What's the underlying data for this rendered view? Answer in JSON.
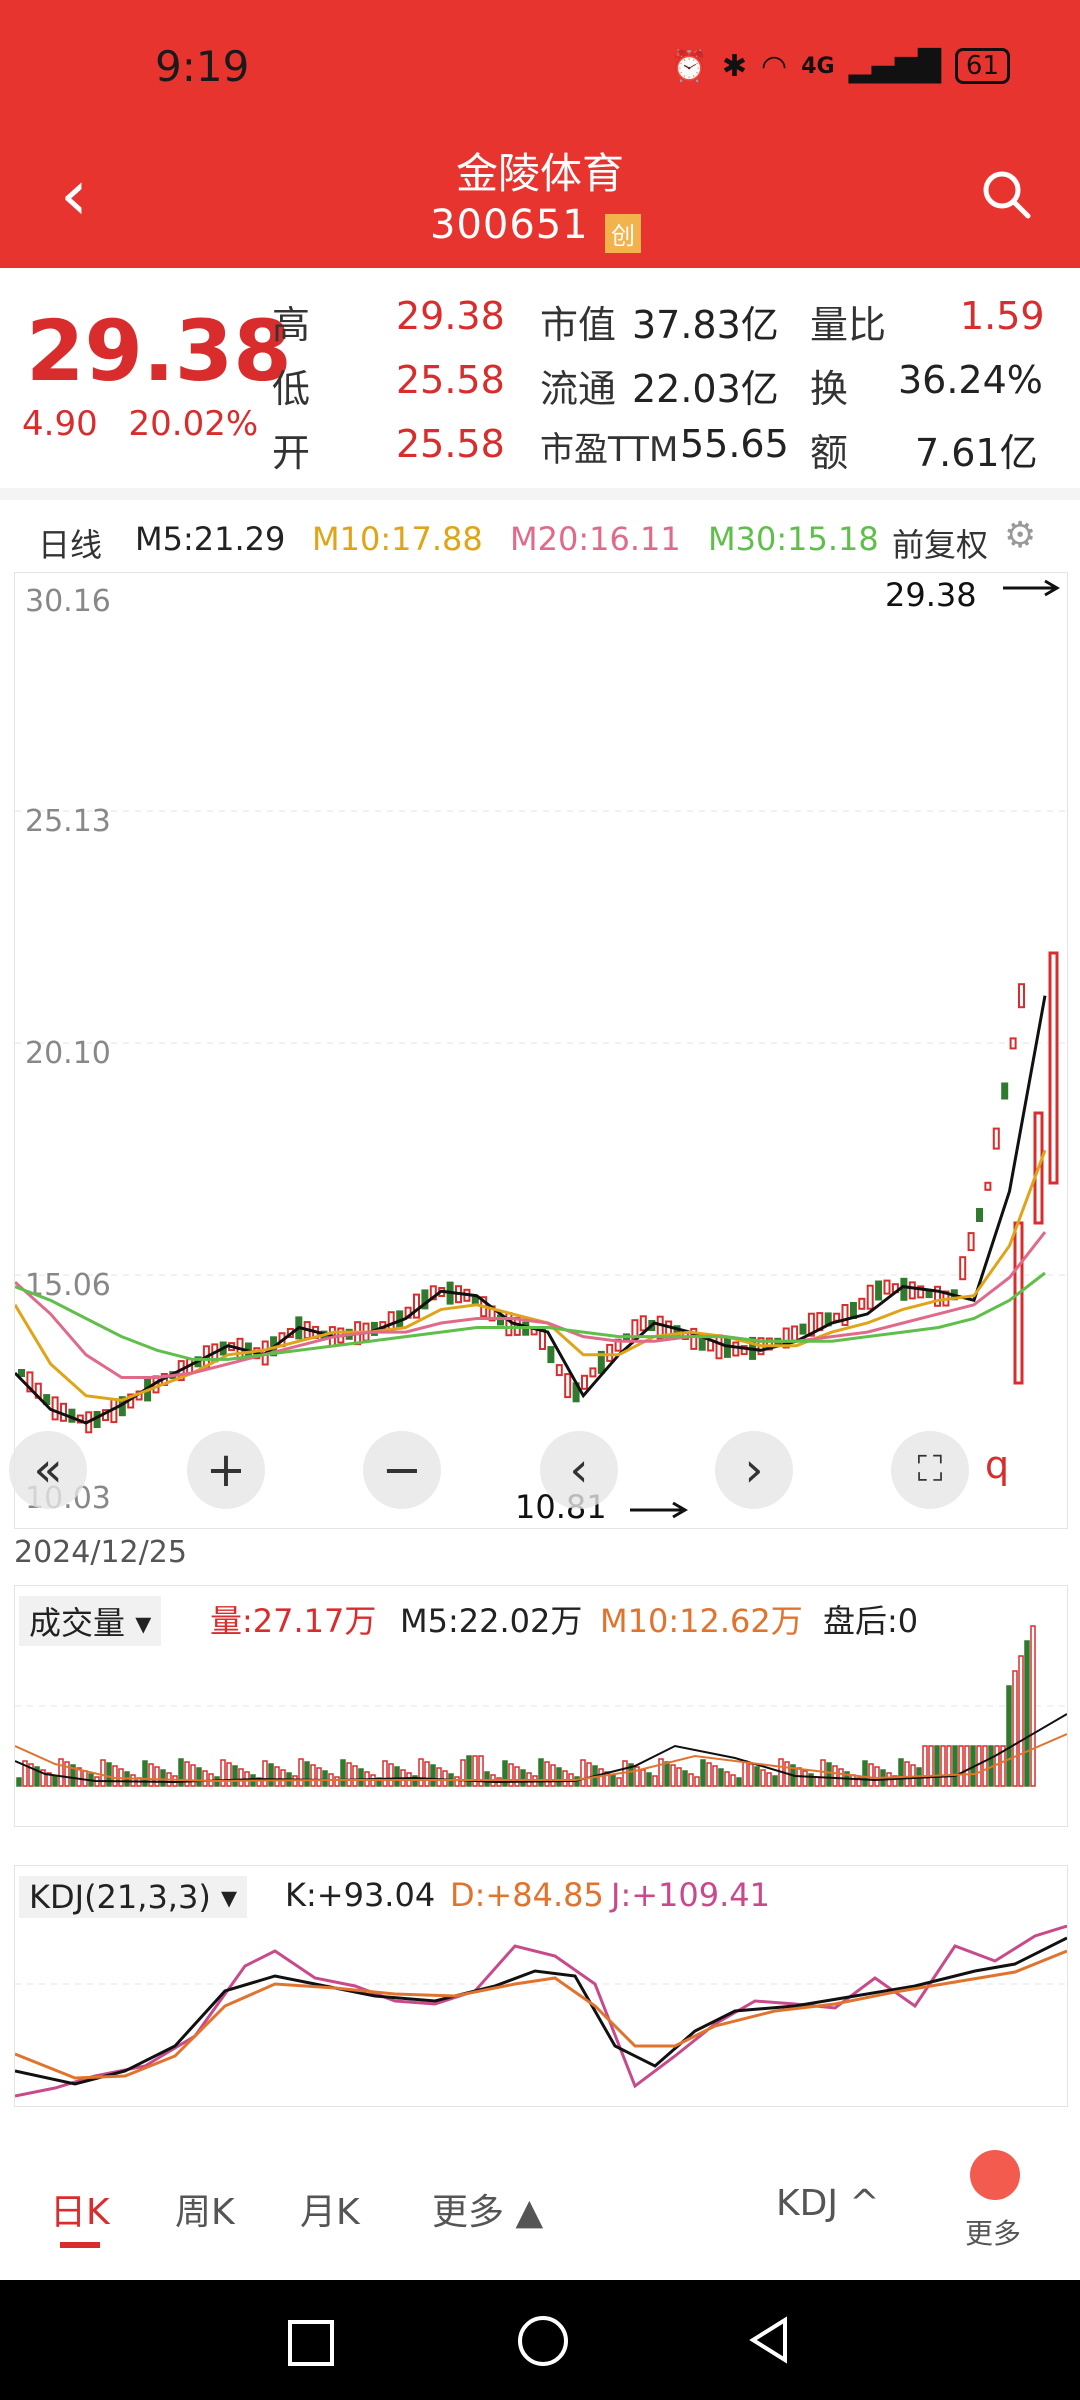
{
  "status_bar": {
    "time": "9:19",
    "battery": "61",
    "network": "4G"
  },
  "header": {
    "title": "金陵体育",
    "code": "300651",
    "badge": "创"
  },
  "quote": {
    "price": "29.38",
    "change": "4.90",
    "change_pct": "20.02%",
    "high_label": "高",
    "high": "29.38",
    "low_label": "低",
    "low": "25.58",
    "open_label": "开",
    "open": "25.58",
    "mcap_label": "市值",
    "mcap": "37.83亿",
    "float_label": "流通",
    "float": "22.03亿",
    "pe_label": "市盈TTM",
    "pe": "55.65",
    "vr_label": "量比",
    "vr": "1.59",
    "turn_label": "换",
    "turn": "36.24%",
    "amt_label": "额",
    "amt": "7.61亿"
  },
  "ma_bar": {
    "period": "日线",
    "m5": "M5:21.29",
    "m10": "M10:17.88",
    "m20": "M20:16.11",
    "m30": "M30:15.18",
    "adjust": "前复权"
  },
  "price_chart": {
    "y_labels": [
      "30.16",
      "25.13",
      "20.10",
      "15.06",
      "10.03"
    ],
    "max_label": "29.38",
    "min_label": "10.81"
  },
  "date": "2024/12/25",
  "volume": {
    "title": "成交量",
    "vol": "量:27.17万",
    "m5": "M5:22.02万",
    "m10": "M10:12.62万",
    "after": "盘后:0"
  },
  "kdj": {
    "title": "KDJ(21,3,3)",
    "k": "K:+93.04",
    "d": "D:+84.85",
    "j": "J:+109.41"
  },
  "tabs": {
    "day": "日K",
    "week": "周K",
    "month": "月K",
    "more": "更多",
    "indicator": "KDJ",
    "more2": "更多"
  },
  "colors": {
    "brand": "#e8342f",
    "up": "#d92d2d",
    "down": "#2f7a2f",
    "m10": "#e0a419",
    "m20": "#e06a8a",
    "m30": "#5fbf4a"
  },
  "chart_data": {
    "type": "line",
    "series": [
      {
        "name": "M5",
        "values": [
          13.0,
          12.2,
          11.9,
          12.3,
          12.8,
          13.2,
          13.6,
          13.4,
          14.0,
          13.8,
          13.9,
          14.2,
          14.8,
          14.7,
          14.1,
          13.9,
          12.5,
          13.4,
          14.1,
          13.9,
          13.6,
          13.5,
          13.7,
          14.1,
          14.3,
          14.9,
          14.8,
          14.6,
          17.0,
          21.3
        ]
      },
      {
        "name": "M10",
        "values": [
          14.5,
          13.2,
          12.5,
          12.4,
          12.7,
          13.0,
          13.4,
          13.5,
          13.7,
          13.9,
          13.9,
          14.0,
          14.4,
          14.5,
          14.3,
          14.1,
          13.4,
          13.4,
          13.8,
          13.9,
          13.8,
          13.6,
          13.6,
          13.9,
          14.1,
          14.4,
          14.6,
          14.7,
          15.8,
          17.9
        ]
      },
      {
        "name": "M20",
        "values": [
          15.0,
          14.3,
          13.4,
          12.9,
          12.9,
          13.0,
          13.2,
          13.4,
          13.6,
          13.8,
          13.9,
          13.9,
          14.1,
          14.2,
          14.2,
          14.1,
          13.8,
          13.7,
          13.7,
          13.8,
          13.8,
          13.7,
          13.7,
          13.8,
          13.9,
          14.1,
          14.3,
          14.5,
          15.1,
          16.1
        ]
      },
      {
        "name": "M30",
        "values": [
          14.9,
          14.6,
          14.2,
          13.8,
          13.5,
          13.3,
          13.3,
          13.4,
          13.5,
          13.6,
          13.7,
          13.8,
          13.9,
          14.0,
          14.0,
          14.0,
          13.9,
          13.8,
          13.8,
          13.8,
          13.8,
          13.7,
          13.7,
          13.7,
          13.8,
          13.9,
          14.0,
          14.2,
          14.6,
          15.2
        ]
      }
    ],
    "ylim": [
      10.03,
      30.16
    ]
  }
}
